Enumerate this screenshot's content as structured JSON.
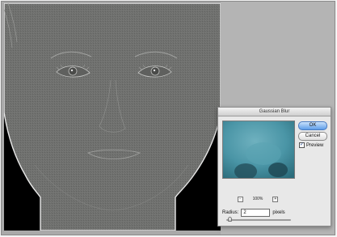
{
  "dialog": {
    "title": "Gaussian Blur",
    "ok_label": "OK",
    "cancel_label": "Cancel",
    "preview_label": "Preview",
    "preview_checked": true,
    "zoom": "100%",
    "zoom_out_label": "-",
    "zoom_in_label": "+",
    "radius_label": "Radius:",
    "radius_value": "2",
    "radius_unit": "pixels",
    "radius_slider_fraction": 0.02
  },
  "colors": {
    "canvas_background": "#000000",
    "high_pass_gray": "#6e6f6d",
    "preview_teal": "#3e8797",
    "ok_button_blue": "#5e9ee9"
  },
  "icons": {
    "zoom_out": "minus-icon",
    "zoom_in": "plus-icon",
    "checkmark": "check-icon"
  }
}
